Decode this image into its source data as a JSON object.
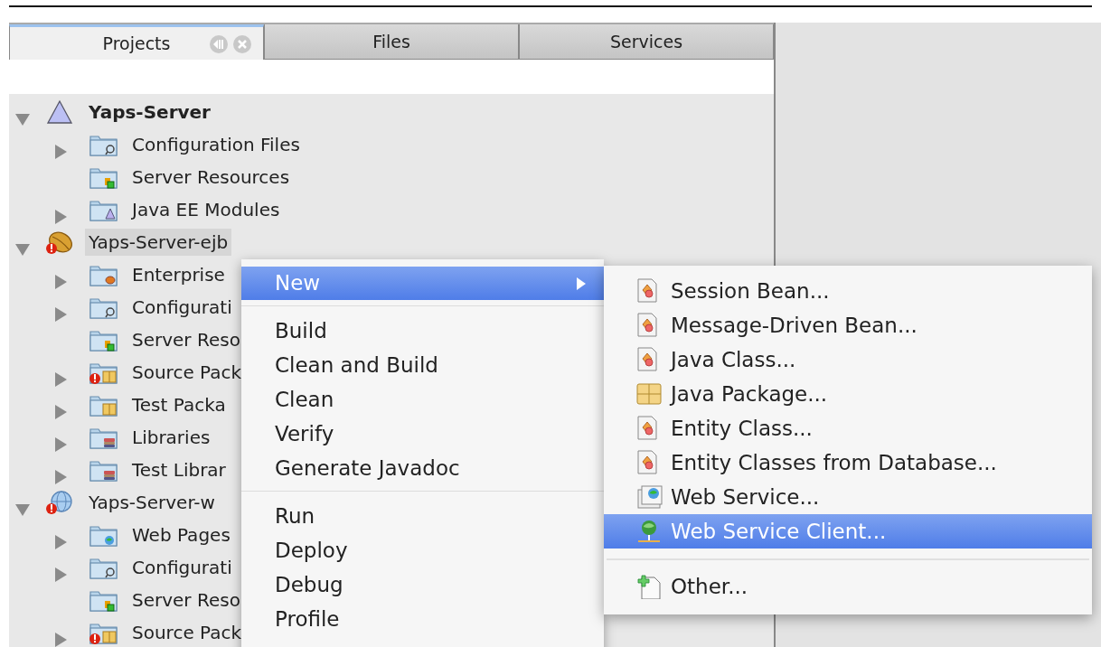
{
  "tabs": [
    {
      "label": "Projects",
      "selected": true,
      "closable": true
    },
    {
      "label": "Files",
      "selected": false,
      "closable": false
    },
    {
      "label": "Services",
      "selected": false,
      "closable": false
    }
  ],
  "tree": [
    {
      "label": "Yaps-Server",
      "kind": "ear",
      "main": true,
      "selected": false,
      "error": false,
      "expanded": true,
      "children": [
        {
          "label": "Configuration Files",
          "kind": "config",
          "expandable": true,
          "error": false
        },
        {
          "label": "Server Resources",
          "kind": "resources",
          "expandable": false,
          "error": false
        },
        {
          "label": "Java EE Modules",
          "kind": "modules",
          "expandable": true,
          "error": false
        }
      ]
    },
    {
      "label": "Yaps-Server-ejb",
      "kind": "ejb",
      "main": false,
      "selected": true,
      "error": true,
      "expanded": true,
      "children": [
        {
          "label": "Enterprise",
          "kind": "beans",
          "expandable": true,
          "error": false
        },
        {
          "label": "Configurati",
          "kind": "config",
          "expandable": true,
          "error": false
        },
        {
          "label": "Server Reso",
          "kind": "resources",
          "expandable": false,
          "error": false
        },
        {
          "label": "Source Pack",
          "kind": "source",
          "expandable": true,
          "error": true
        },
        {
          "label": "Test Packa",
          "kind": "source",
          "expandable": true,
          "error": false
        },
        {
          "label": "Libraries",
          "kind": "libraries",
          "expandable": true,
          "error": false
        },
        {
          "label": "Test Librar",
          "kind": "libraries",
          "expandable": true,
          "error": false
        }
      ]
    },
    {
      "label": "Yaps-Server-w",
      "kind": "war",
      "main": false,
      "selected": false,
      "error": true,
      "expanded": true,
      "children": [
        {
          "label": "Web Pages",
          "kind": "web",
          "expandable": true,
          "error": false
        },
        {
          "label": "Configurati",
          "kind": "config",
          "expandable": true,
          "error": false
        },
        {
          "label": "Server Reso",
          "kind": "resources",
          "expandable": false,
          "error": false
        },
        {
          "label": "Source Pack",
          "kind": "source",
          "expandable": true,
          "error": true
        }
      ]
    }
  ],
  "context_menu": {
    "items": [
      {
        "kind": "item",
        "label": "New",
        "selected": true,
        "has_submenu": true
      },
      {
        "kind": "separator"
      },
      {
        "kind": "item",
        "label": "Build",
        "selected": false,
        "has_submenu": false
      },
      {
        "kind": "item",
        "label": "Clean and Build",
        "selected": false,
        "has_submenu": false
      },
      {
        "kind": "item",
        "label": "Clean",
        "selected": false,
        "has_submenu": false
      },
      {
        "kind": "item",
        "label": "Verify",
        "selected": false,
        "has_submenu": false
      },
      {
        "kind": "item",
        "label": "Generate Javadoc",
        "selected": false,
        "has_submenu": false
      },
      {
        "kind": "separator"
      },
      {
        "kind": "item",
        "label": "Run",
        "selected": false,
        "has_submenu": false
      },
      {
        "kind": "item",
        "label": "Deploy",
        "selected": false,
        "has_submenu": false
      },
      {
        "kind": "item",
        "label": "Debug",
        "selected": false,
        "has_submenu": false
      },
      {
        "kind": "item",
        "label": "Profile",
        "selected": false,
        "has_submenu": false
      }
    ]
  },
  "submenu": {
    "items": [
      {
        "kind": "class",
        "label": "Session Bean...",
        "selected": false
      },
      {
        "kind": "class",
        "label": "Message-Driven Bean...",
        "selected": false
      },
      {
        "kind": "class",
        "label": "Java Class...",
        "selected": false
      },
      {
        "kind": "package",
        "label": "Java Package...",
        "selected": false
      },
      {
        "kind": "class",
        "label": "Entity Class...",
        "selected": false
      },
      {
        "kind": "class",
        "label": "Entity Classes from Database...",
        "selected": false
      },
      {
        "kind": "webservice",
        "label": "Web Service...",
        "selected": false
      },
      {
        "kind": "wsclient",
        "label": "Web Service Client...",
        "selected": true
      },
      {
        "kind": "separator"
      },
      {
        "kind": "other",
        "label": "Other...",
        "selected": false
      }
    ]
  }
}
